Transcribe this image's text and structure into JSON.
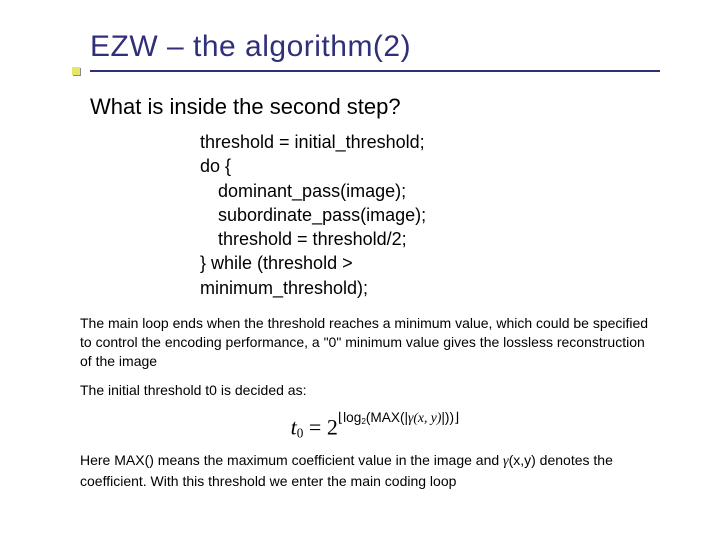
{
  "title": "EZW – the algorithm(2)",
  "subhead": "What is inside the second step?",
  "code": {
    "l1": "threshold = initial_threshold;",
    "l2": "do {",
    "l3": "dominant_pass(image);",
    "l4": "subordinate_pass(image);",
    "l5": "threshold = threshold/2;",
    "l6": "} while (threshold >",
    "l7": "minimum_threshold);"
  },
  "para1": "The main loop ends when the threshold reaches a minimum value, which could be specified to control the encoding performance, a \"0\" minimum value gives the lossless reconstruction of the image",
  "para2": "The initial threshold t0 is decided as:",
  "formula": {
    "lhs_var": "t",
    "lhs_sub": "0",
    "eq": "=",
    "base": "2",
    "exp_log": "log",
    "exp_log_sub": "2",
    "exp_max_open": "(MAX(|",
    "exp_gamma": "γ",
    "exp_args": "(x, y)",
    "exp_close": "|))"
  },
  "para3_a": "Here MAX() means the maximum coefficient value in the image and ",
  "para3_gamma": "γ",
  "para3_b": "(x,y) denotes the coefficient. With this threshold we enter the main coding loop"
}
